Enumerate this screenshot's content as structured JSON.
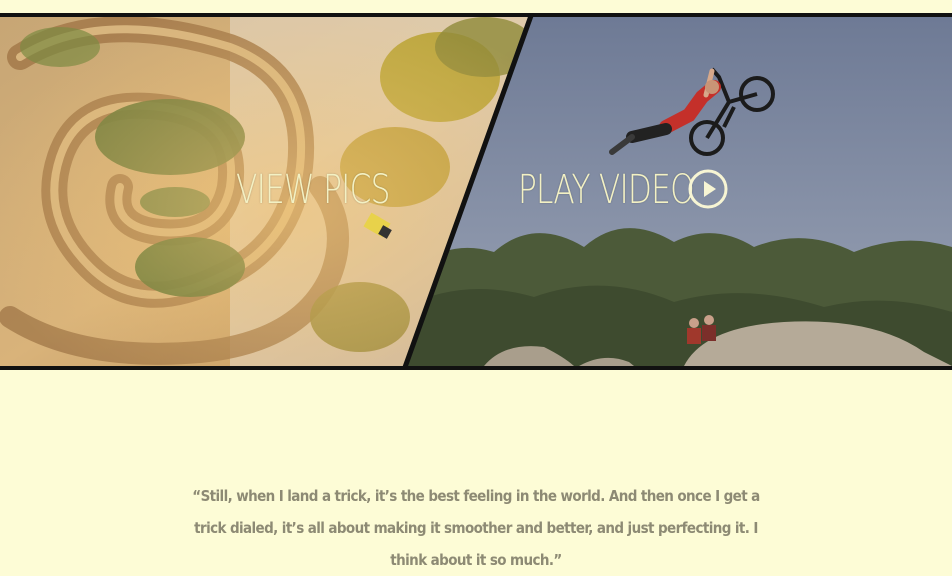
{
  "panels": {
    "pics": {
      "label": "VIEW PICS"
    },
    "video": {
      "label": "PLAY VIDEO",
      "icon": "play-circle-icon"
    }
  },
  "quote": {
    "text": "“Still, when I land a trick, it’s the best feeling in the world. And then once I get a trick dialed, it’s all about making it smoother and better, and just perfecting it. I think about it so much.”"
  },
  "colors": {
    "background": "#fdfcd6",
    "border": "#111111",
    "label": "#f3f1c4",
    "quote": "#8d8a74"
  }
}
